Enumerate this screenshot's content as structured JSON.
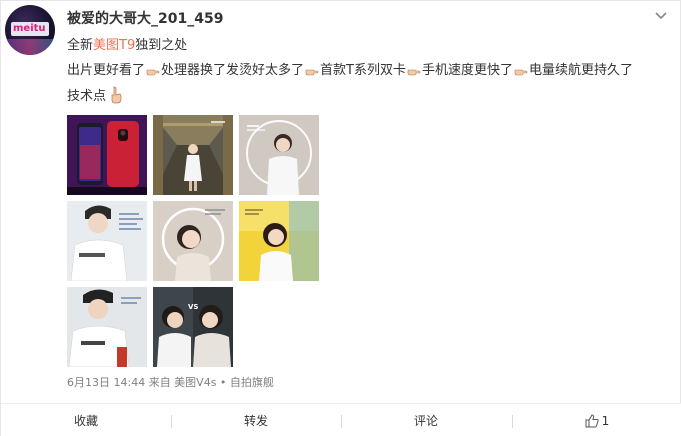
{
  "post": {
    "username": "被爱的大哥大_201_459",
    "avatar_text": "meitu",
    "line1": {
      "prefix": "全新",
      "link": "美图T9",
      "suffix": "独到之处"
    },
    "line2": {
      "s1": "出片更好看了",
      "s2": "处理器换了发烫好太多了",
      "s3": "首款T系列双卡",
      "s4": "手机速度更快了",
      "s5": "电量续航更持久了"
    },
    "line3": "技术点",
    "meta": "6月13日 14:44 来自 美图V4s • 自拍旗舰",
    "images": [
      {
        "name": "image-red-phones",
        "icon": "phone-image"
      },
      {
        "name": "image-girl-corridor",
        "icon": "portrait-image"
      },
      {
        "name": "image-girl-circle-light",
        "icon": "portrait-image"
      },
      {
        "name": "image-boy-white-shirt",
        "icon": "portrait-image"
      },
      {
        "name": "image-girl-ring-portrait",
        "icon": "portrait-image"
      },
      {
        "name": "image-girl-yellow-wall",
        "icon": "portrait-image"
      },
      {
        "name": "image-boy-photo-2",
        "icon": "portrait-image"
      },
      {
        "name": "image-couple-vs",
        "icon": "portrait-image",
        "overlay_text": "VS"
      }
    ]
  },
  "actions": {
    "favorite": "收藏",
    "forward": "转发",
    "comment": "评论",
    "like_count": "1"
  },
  "colors": {
    "link": "#eb7350",
    "text": "#333333",
    "meta": "#808080"
  }
}
